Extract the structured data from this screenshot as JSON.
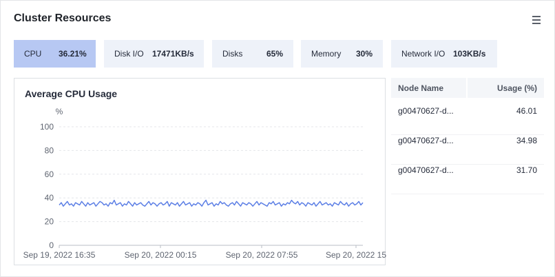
{
  "header": {
    "title": "Cluster Resources"
  },
  "tabs": [
    {
      "label": "CPU",
      "value": "36.21%",
      "active": true
    },
    {
      "label": "Disk I/O",
      "value": "17471KB/s",
      "active": false
    },
    {
      "label": "Disks",
      "value": "65%",
      "active": false
    },
    {
      "label": "Memory",
      "value": "30%",
      "active": false
    },
    {
      "label": "Network I/O",
      "value": "103KB/s",
      "active": false
    }
  ],
  "chart_data": {
    "type": "line",
    "title": "Average CPU Usage",
    "ylabel": "%",
    "ylim": [
      0,
      100
    ],
    "yticks": [
      0,
      20,
      40,
      60,
      80,
      100
    ],
    "xticks": [
      "Sep 19, 2022 16:35",
      "Sep 20, 2022 00:15",
      "Sep 20, 2022 07:55",
      "Sep 20, 2022 15"
    ],
    "grid": true,
    "series": [
      {
        "color": "#5b7ee5",
        "values": [
          34,
          36,
          33,
          35,
          37,
          34,
          35,
          33,
          36,
          35,
          34,
          37,
          35,
          33,
          36,
          34,
          35,
          36,
          33,
          35,
          37,
          36,
          34,
          35,
          33,
          36,
          35,
          38,
          34,
          35,
          36,
          33,
          35,
          34,
          37,
          35,
          33,
          36,
          34,
          35,
          36,
          34,
          33,
          35,
          37,
          34,
          36,
          35,
          33,
          35,
          36,
          34,
          35,
          37,
          33,
          36,
          35,
          34,
          36,
          33,
          35,
          37,
          34,
          35,
          36,
          33,
          35,
          34,
          36,
          35,
          33,
          36,
          38,
          34,
          35,
          36,
          33,
          35,
          34,
          37,
          35,
          36,
          34,
          33,
          35,
          36,
          34,
          37,
          35,
          33,
          36,
          35,
          34,
          36,
          35,
          33,
          35,
          37,
          34,
          36,
          35,
          34,
          33,
          36,
          35,
          37,
          34,
          35,
          36,
          33,
          35,
          34,
          36,
          35,
          38,
          36,
          35,
          37,
          34,
          36,
          35,
          33,
          36,
          35,
          34,
          36,
          33,
          35,
          37,
          34,
          35,
          36,
          34,
          35,
          33,
          36,
          35,
          34,
          37,
          35,
          34,
          36,
          33,
          35,
          36,
          34,
          35,
          37,
          34,
          36
        ]
      }
    ]
  },
  "node_table": {
    "headers": [
      "Node Name",
      "Usage (%)"
    ],
    "rows": [
      {
        "name": "g00470627-d...",
        "usage": "46.01"
      },
      {
        "name": "g00470627-d...",
        "usage": "34.98"
      },
      {
        "name": "g00470627-d...",
        "usage": "31.70"
      }
    ]
  },
  "icons": {
    "menu": "hamburger-menu-icon"
  }
}
